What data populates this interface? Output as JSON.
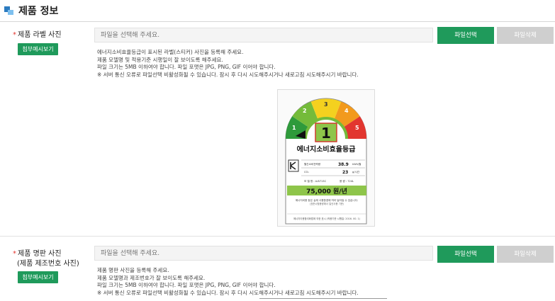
{
  "section": {
    "title": "제품 정보"
  },
  "label_photo": {
    "label": "제품 라벨 사진",
    "required_mark": "*",
    "example_button": "첨부예시보기",
    "placeholder": "파일을 선택해 주세요.",
    "select_button": "파일선택",
    "delete_button": "파일삭제",
    "help": [
      "에너지소비효율등급이 표시된 라벨(스티커) 사진을 등록해 주세요.",
      "제품 모델명 및 적용기준 시행일이 잘 보이도록 해주세요.",
      "파일 크기는 5MB 이하여야 합니다. 파일 포맷은 JPG, PNG, GIF 이어야 합니다.",
      "※ 서버 통신 오류로 파일선택 비활성화될 수 있습니다. 잠시 후 다시 시도해주시거나 새로고침 시도해주시기 바랍니다."
    ]
  },
  "energy_label": {
    "grade": "1",
    "gauge_numbers": [
      "1",
      "2",
      "3",
      "4",
      "5"
    ],
    "title": "에너지소비효율등급",
    "row1_label": "월간소비전력량",
    "row1_value": "38.9",
    "row1_unit": "kWh/월",
    "row2_label": "CO₂",
    "row2_value": "23",
    "row2_unit": "g/시간",
    "model": "모 델 명 : A-B713C",
    "capacity": "용    량 : 724L",
    "cost": "75,000 원/년",
    "note1": "에너지비용 등은 실제 사용환경에 따라 달라질 수 있습니다.",
    "note2": "(표준시험용량에서 일년사용 기준)",
    "footer": "에너지이용합리화법에 의한 표시 (적용기준 시행일: 2016. 00. 1)",
    "colors": {
      "dark_green": "#2e9a3b",
      "green": "#74bb3a",
      "yellow": "#f4d11f",
      "orange": "#f29a1d",
      "red": "#e2362f"
    }
  },
  "nameplate_photo": {
    "label_line1": "제품 명판 사진",
    "label_line2": "(제품 제조번호 사진)",
    "required_mark": "*",
    "example_button": "첨부예시보기",
    "placeholder": "파일을 선택해 주세요.",
    "select_button": "파일선택",
    "delete_button": "파일삭제",
    "help": [
      "제품 명판 사진을 등록해 주세요.",
      "제품 모델명과 제조번호가 잘 보이도록 해주세요.",
      "파일 크기는 5MB 이하여야 합니다. 파일 포맷은 JPG, PNG, GIF 이어야 합니다.",
      "※ 서버 통신 오류로 파일선택 비활성화될 수 있습니다. 잠시 후 다시 시도해주시거나 새로고침 시도해주시기 바랍니다."
    ]
  }
}
